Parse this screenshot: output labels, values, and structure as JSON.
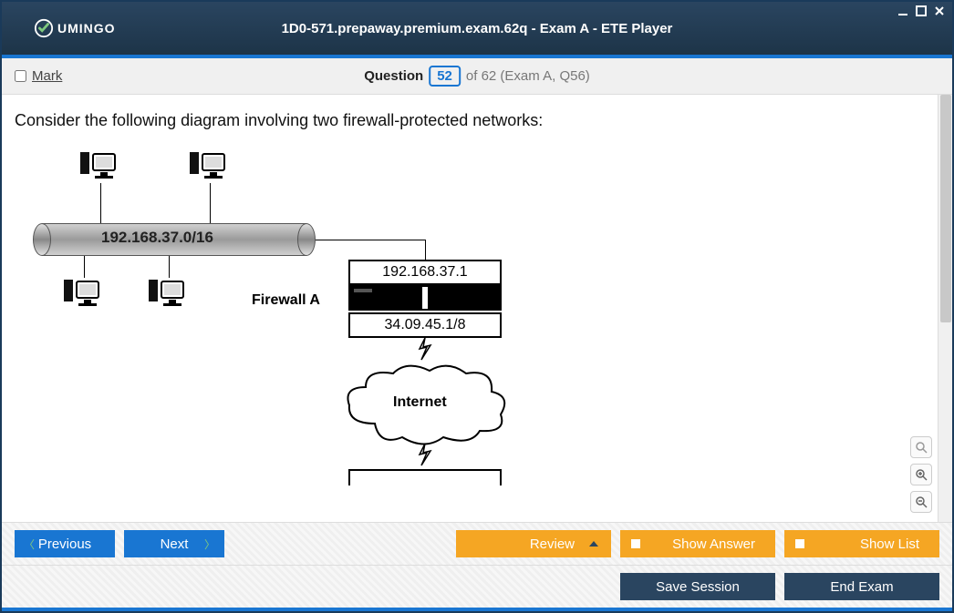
{
  "window": {
    "title": "1D0-571.prepaway.premium.exam.62q - Exam A - ETE Player",
    "brand": "UMINGO"
  },
  "header": {
    "mark_label": "Mark",
    "question_word": "Question",
    "current_number": "52",
    "of_text": "of 62 (Exam A, Q56)"
  },
  "question": {
    "text": "Consider the following diagram involving two firewall-protected networks:"
  },
  "diagram": {
    "subnet": "192.168.37.0/16",
    "firewall_a_label": "Firewall A",
    "fw_a_inside_ip": "192.168.37.1",
    "fw_a_outside_ip": "34.09.45.1/8",
    "cloud_label": "Internet"
  },
  "toolbar": {
    "previous": "Previous",
    "next": "Next",
    "review": "Review",
    "show_answer": "Show Answer",
    "show_list": "Show List",
    "save_session": "Save Session",
    "end_exam": "End Exam"
  }
}
